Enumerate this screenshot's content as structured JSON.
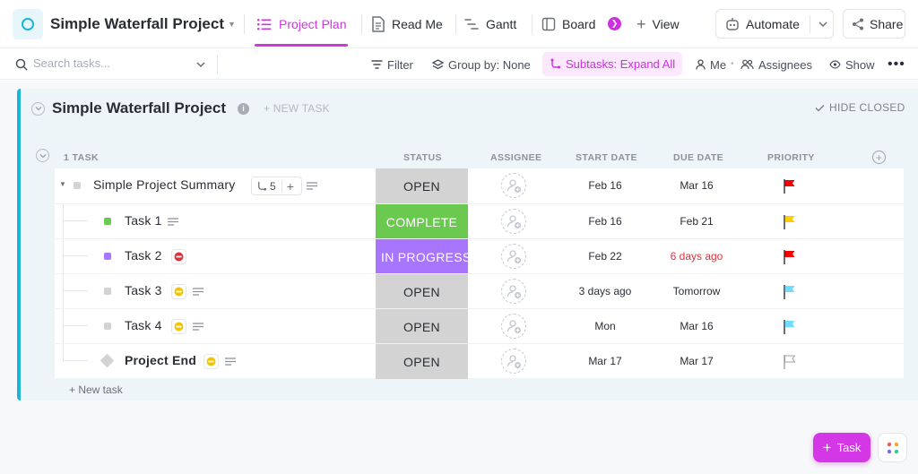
{
  "header": {
    "project_title": "Simple Waterfall Project",
    "tabs": [
      {
        "label": "Project Plan",
        "active": true
      },
      {
        "label": "Read Me"
      },
      {
        "label": "Gantt"
      },
      {
        "label": "Board"
      }
    ],
    "add_view_label": "View",
    "automate_label": "Automate",
    "share_label": "Share"
  },
  "toolbar": {
    "search_placeholder": "Search tasks...",
    "filter_label": "Filter",
    "group_by_label": "Group by: None",
    "subtasks_label": "Subtasks: Expand All",
    "me_label": "Me",
    "assignees_label": "Assignees",
    "show_label": "Show"
  },
  "list": {
    "title": "Simple Waterfall Project",
    "new_task_label": "+ NEW TASK",
    "hide_closed_label": "HIDE CLOSED",
    "task_count_label": "1 TASK",
    "columns": {
      "status": "STATUS",
      "assignee": "ASSIGNEE",
      "start_date": "START DATE",
      "due_date": "DUE DATE",
      "priority": "PRIORITY"
    },
    "tasks": [
      {
        "name": "Simple Project Summary",
        "subtask_count": "5",
        "status": "OPEN",
        "status_color": "#d3d3d3",
        "start": "Feb 16",
        "due": "Mar 16",
        "due_overdue": false,
        "priority_color": "#f50000",
        "square_color": "#d3d3d3"
      },
      {
        "name": "Task 1",
        "status": "COMPLETE",
        "status_color": "#6bc950",
        "start": "Feb 16",
        "due": "Feb 21",
        "due_overdue": false,
        "priority_color": "#ffcc00",
        "square_color": "#6bc950"
      },
      {
        "name": "Task 2",
        "status": "IN PROGRESS",
        "status_color": "#a875ff",
        "start": "Feb 22",
        "due": "6 days ago",
        "due_overdue": true,
        "priority_color": "#f50000",
        "square_color": "#a875ff"
      },
      {
        "name": "Task 3",
        "status": "OPEN",
        "status_color": "#d3d3d3",
        "start": "3 days ago",
        "due": "Tomorrow",
        "due_overdue": false,
        "priority_color": "#6fddff",
        "square_color": "#d3d3d3"
      },
      {
        "name": "Task 4",
        "status": "OPEN",
        "status_color": "#d3d3d3",
        "start": "Mon",
        "due": "Mar 16",
        "due_overdue": false,
        "priority_color": "#6fddff",
        "square_color": "#d3d3d3"
      },
      {
        "name": "Project End",
        "status": "OPEN",
        "status_color": "#d3d3d3",
        "start": "Mar 17",
        "due": "Mar 17",
        "due_overdue": false,
        "priority_color": "#d8d8d8",
        "square_color": "#d3d3d3"
      }
    ],
    "new_task_bottom_label": "+ New task"
  },
  "fab": {
    "task_label": "Task"
  },
  "colors": {
    "accent": "#d036e0",
    "list_stripe": "#1bb6d6",
    "overdue": "#e0313a"
  }
}
